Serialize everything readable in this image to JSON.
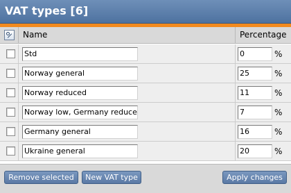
{
  "header": {
    "title": "VAT types [6]"
  },
  "columns": {
    "name": "Name",
    "percentage": "Percentage"
  },
  "percent_symbol": "%",
  "rows": [
    {
      "name": "Std",
      "percentage": "0"
    },
    {
      "name": "Norway general",
      "percentage": "25"
    },
    {
      "name": "Norway reduced",
      "percentage": "11"
    },
    {
      "name": "Norway low, Germany reduced",
      "percentage": "7"
    },
    {
      "name": "Germany general",
      "percentage": "16"
    },
    {
      "name": "Ukraine general",
      "percentage": "20"
    }
  ],
  "footer": {
    "remove_label": "Remove selected",
    "new_label": "New VAT type",
    "apply_label": "Apply changes"
  },
  "colors": {
    "header": "#5a7aa6",
    "accent": "#f28a1e",
    "button": "#6b89b3"
  }
}
